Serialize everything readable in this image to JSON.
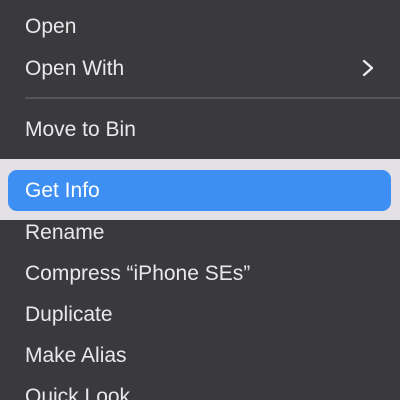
{
  "menu": {
    "items": [
      {
        "label": "Open"
      },
      {
        "label": "Open With",
        "submenu_icon": "chevron-right-icon"
      },
      {
        "label": "Move to Bin"
      },
      {
        "label": "Get Info",
        "selected": true
      },
      {
        "label": "Rename"
      },
      {
        "label": "Compress “iPhone SEs”"
      },
      {
        "label": "Duplicate"
      },
      {
        "label": "Make Alias"
      },
      {
        "label": "Quick Look"
      }
    ],
    "colors": {
      "background": "#3a393b",
      "text": "#e9e8ea",
      "highlight": "#3d8ff4",
      "focus_band": "#e3e1e5"
    }
  }
}
